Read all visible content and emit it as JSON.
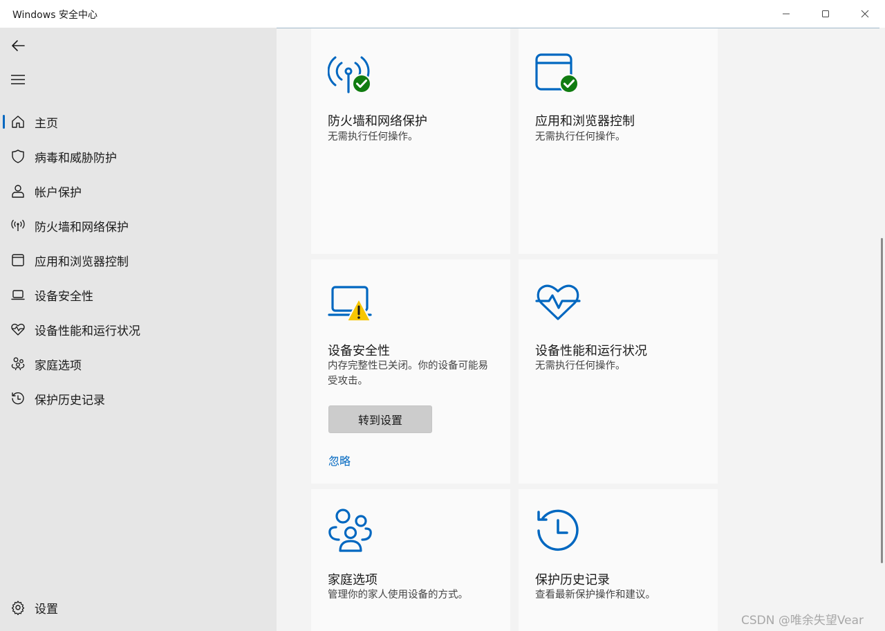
{
  "window": {
    "title": "Windows 安全中心"
  },
  "sidebar": {
    "back_icon": "back-arrow-icon",
    "menu_icon": "hamburger-icon",
    "items": [
      {
        "label": "主页",
        "icon": "home-icon",
        "selected": true
      },
      {
        "label": "病毒和威胁防护",
        "icon": "shield-icon",
        "selected": false
      },
      {
        "label": "帐户保护",
        "icon": "person-icon",
        "selected": false
      },
      {
        "label": "防火墙和网络保护",
        "icon": "antenna-icon",
        "selected": false
      },
      {
        "label": "应用和浏览器控制",
        "icon": "app-window-icon",
        "selected": false
      },
      {
        "label": "设备安全性",
        "icon": "laptop-icon",
        "selected": false
      },
      {
        "label": "设备性能和运行状况",
        "icon": "heart-pulse-icon",
        "selected": false
      },
      {
        "label": "家庭选项",
        "icon": "family-icon",
        "selected": false
      },
      {
        "label": "保护历史记录",
        "icon": "history-icon",
        "selected": false
      }
    ],
    "settings_label": "设置"
  },
  "cards": [
    {
      "title": "防火墙和网络保护",
      "desc": "无需执行任何操作。",
      "icon": "antenna-check-icon",
      "status": "ok"
    },
    {
      "title": "应用和浏览器控制",
      "desc": "无需执行任何操作。",
      "icon": "app-window-check-icon",
      "status": "ok"
    },
    {
      "title": "设备安全性",
      "desc": "内存完整性已关闭。你的设备可能易受攻击。",
      "icon": "laptop-warning-icon",
      "status": "warning",
      "button_label": "转到设置",
      "link_label": "忽略"
    },
    {
      "title": "设备性能和运行状况",
      "desc": "无需执行任何操作。",
      "icon": "heart-pulse-icon",
      "status": "ok"
    },
    {
      "title": "家庭选项",
      "desc": "管理你的家人使用设备的方式。",
      "icon": "family-icon"
    },
    {
      "title": "保护历史记录",
      "desc": "查看最新保护操作和建议。",
      "icon": "history-icon"
    }
  ],
  "colors": {
    "accent": "#0067c0",
    "ok_green": "#107c10",
    "warning_yellow": "#f7c600"
  },
  "watermark": "CSDN @唯余失望Vear"
}
